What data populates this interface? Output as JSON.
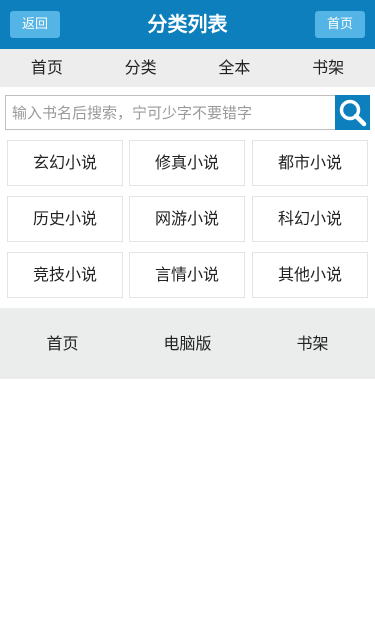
{
  "header": {
    "back_label": "返回",
    "title": "分类列表",
    "home_label": "首页"
  },
  "nav": {
    "items": [
      {
        "label": "首页"
      },
      {
        "label": "分类"
      },
      {
        "label": "全本"
      },
      {
        "label": "书架"
      }
    ]
  },
  "search": {
    "placeholder": "输入书名后搜索，宁可少字不要错字",
    "value": "",
    "icon": "search-icon"
  },
  "categories": [
    {
      "label": "玄幻小说"
    },
    {
      "label": "修真小说"
    },
    {
      "label": "都市小说"
    },
    {
      "label": "历史小说"
    },
    {
      "label": "网游小说"
    },
    {
      "label": "科幻小说"
    },
    {
      "label": "竞技小说"
    },
    {
      "label": "言情小说"
    },
    {
      "label": "其他小说"
    }
  ],
  "footer": {
    "items": [
      {
        "label": "首页"
      },
      {
        "label": "电脑版"
      },
      {
        "label": "书架"
      }
    ]
  },
  "colors": {
    "brand": "#0d7fbd",
    "header_button": "#55b4e6",
    "nav_bg": "#ededed",
    "footer_bg": "#ebeded"
  }
}
